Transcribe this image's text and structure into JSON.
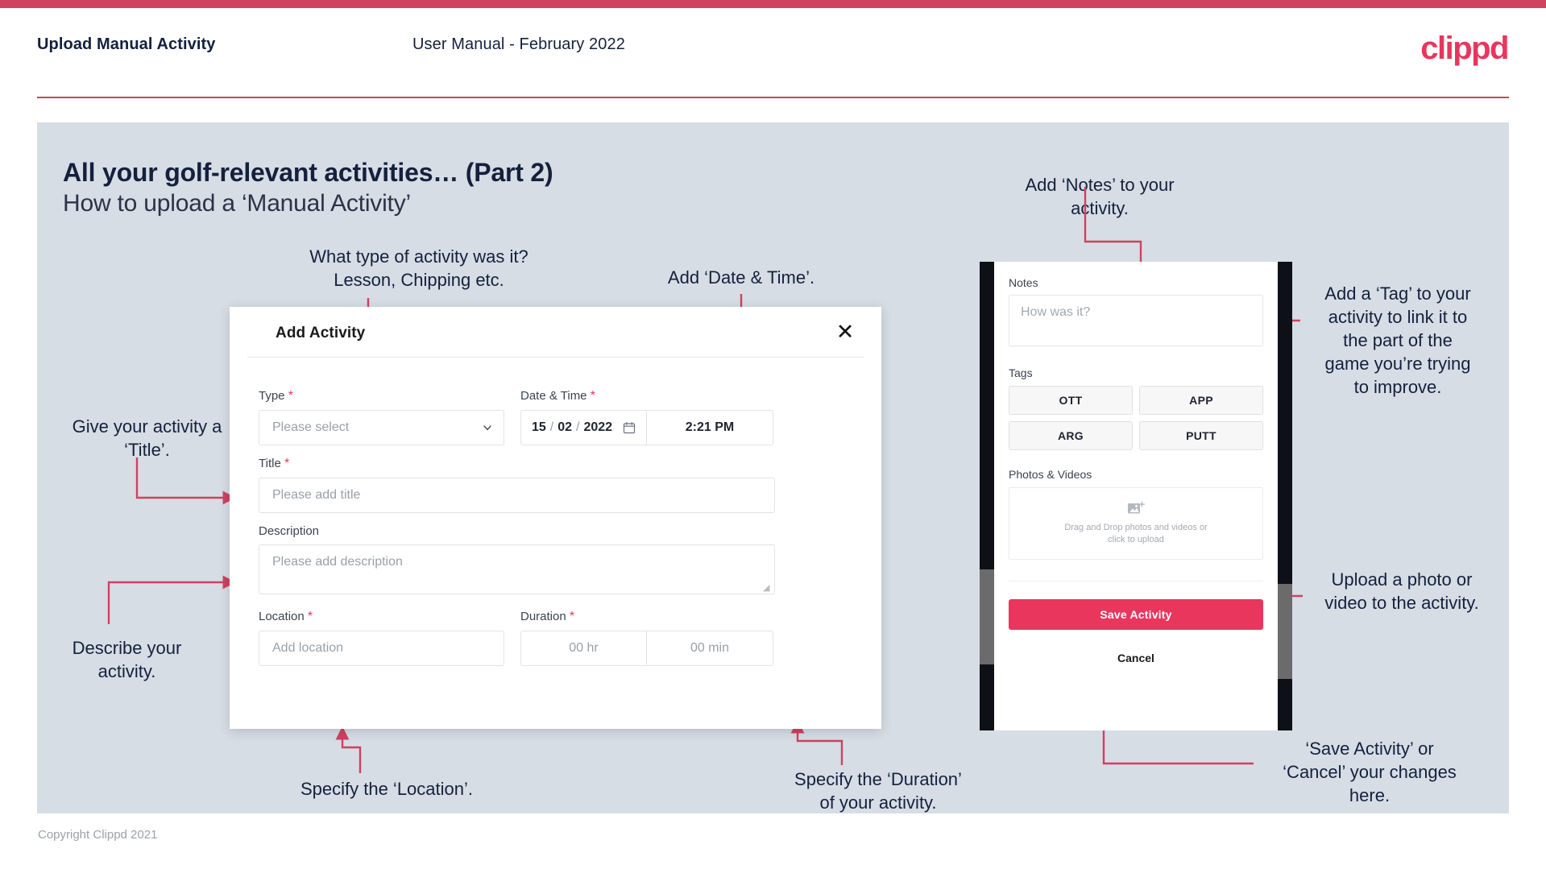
{
  "header": {
    "title": "Upload Manual Activity",
    "subtitle": "User Manual - February 2022",
    "logo": "clippd"
  },
  "slide": {
    "title": "All your golf-relevant activities… (Part 2)",
    "subtitle": "How to upload a ‘Manual Activity’"
  },
  "footer": {
    "copyright": "Copyright Clippd 2021"
  },
  "colors": {
    "brand_pink": "#e8365d",
    "accent_bar": "#cf4260",
    "slide_bg": "#d7dde5",
    "navy_text": "#14213d",
    "arrow": "#cf4260"
  },
  "annotations": [
    {
      "id": "type",
      "lines": [
        "What type of activity was it?",
        "Lesson, Chipping etc."
      ]
    },
    {
      "id": "datetime",
      "lines": [
        "Add ‘Date & Time’."
      ]
    },
    {
      "id": "notes",
      "lines": [
        "Add ‘Notes’ to your",
        "activity."
      ]
    },
    {
      "id": "tag",
      "lines": [
        "Add a ‘Tag’ to your",
        "activity to link it to",
        "the part of the",
        "game you’re trying",
        "to improve."
      ]
    },
    {
      "id": "title",
      "lines": [
        "Give your activity a",
        "‘Title’."
      ]
    },
    {
      "id": "description",
      "lines": [
        "Describe your",
        "activity."
      ]
    },
    {
      "id": "location",
      "lines": [
        "Specify the ‘Location’."
      ]
    },
    {
      "id": "duration",
      "lines": [
        "Specify the ‘Duration’",
        "of your activity."
      ]
    },
    {
      "id": "upload",
      "lines": [
        "Upload a photo or",
        "video to the activity."
      ]
    },
    {
      "id": "save",
      "lines": [
        "‘Save Activity’ or",
        "‘Cancel’ your changes",
        "here."
      ]
    }
  ],
  "dialog": {
    "title": "Add Activity",
    "close_label": "✕",
    "fields": {
      "type": {
        "label": "Type",
        "required": "*",
        "placeholder": "Please select"
      },
      "datetime": {
        "label": "Date & Time",
        "required": "*",
        "day": "15",
        "month": "02",
        "year": "2022",
        "sep": "/",
        "time": "2:21 PM"
      },
      "title": {
        "label": "Title",
        "required": "*",
        "placeholder": "Please add title"
      },
      "description": {
        "label": "Description",
        "required": "",
        "placeholder": "Please add description"
      },
      "location": {
        "label": "Location",
        "required": "*",
        "placeholder": "Add location"
      },
      "duration": {
        "label": "Duration",
        "required": "*",
        "hours_placeholder": "00 hr",
        "minutes_placeholder": "00 min"
      }
    }
  },
  "phone": {
    "notes": {
      "label": "Notes",
      "placeholder": "How was it?"
    },
    "tags": {
      "label": "Tags",
      "items": [
        "OTT",
        "APP",
        "ARG",
        "PUTT"
      ]
    },
    "media": {
      "label": "Photos & Videos",
      "drop_line1": "Drag and Drop photos and videos or",
      "drop_line2": "click to upload"
    },
    "save_label": "Save Activity",
    "cancel_label": "Cancel"
  }
}
